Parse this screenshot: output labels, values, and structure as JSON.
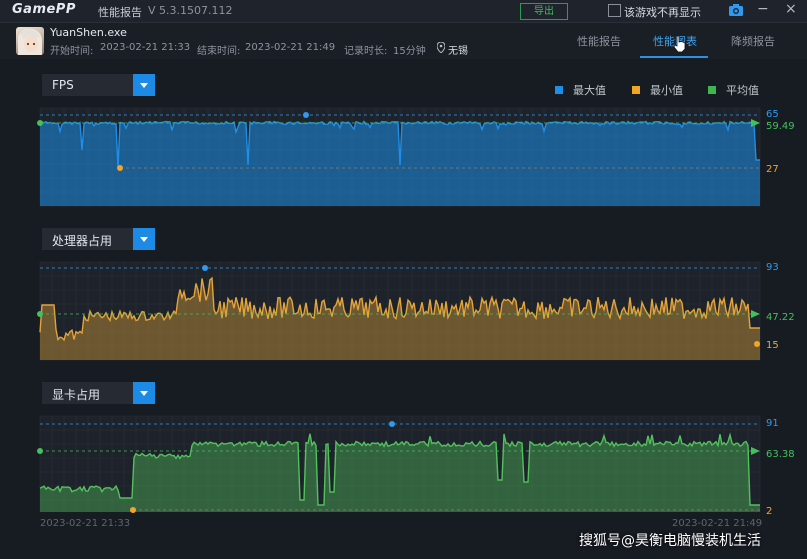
{
  "app": {
    "logo": "GamePP",
    "title": "性能报告",
    "version": "V 5.3.1507.112",
    "export_label": "导出",
    "hide_game_label": "该游戏不再显示"
  },
  "session": {
    "exe": "YuanShen.exe",
    "start_label": "开始时间:",
    "start": "2023-02-21 21:33",
    "end_label": "结束时间:",
    "end": "2023-02-21 21:49",
    "duration_label": "记录时长:",
    "duration": "15分钟",
    "location": "无锡"
  },
  "tabs": [
    "性能报告",
    "性能图表",
    "降频报告"
  ],
  "active_tab": 1,
  "legend": [
    {
      "label": "最大值",
      "color": "#1e8fe8"
    },
    {
      "label": "最小值",
      "color": "#f2a628"
    },
    {
      "label": "平均值",
      "color": "#3fb44f"
    }
  ],
  "charts": [
    {
      "metric": "FPS",
      "max": "65",
      "avg": "59.49",
      "min": "27",
      "color": "#1e8fe8"
    },
    {
      "metric": "处理器占用",
      "max": "93",
      "avg": "47.22",
      "min": "15",
      "color": "#e3a43a"
    },
    {
      "metric": "显卡占用",
      "max": "91",
      "avg": "63.38",
      "min": "2",
      "color": "#52c25c"
    }
  ],
  "time_range": {
    "start": "2023-02-21 21:33",
    "end": "2023-02-21 21:49"
  },
  "watermark": "搜狐号@昊衡电脑慢装机生活",
  "colors": {
    "max": "#2f9af0",
    "min": "#f2a628",
    "avg": "#43c05a"
  }
}
